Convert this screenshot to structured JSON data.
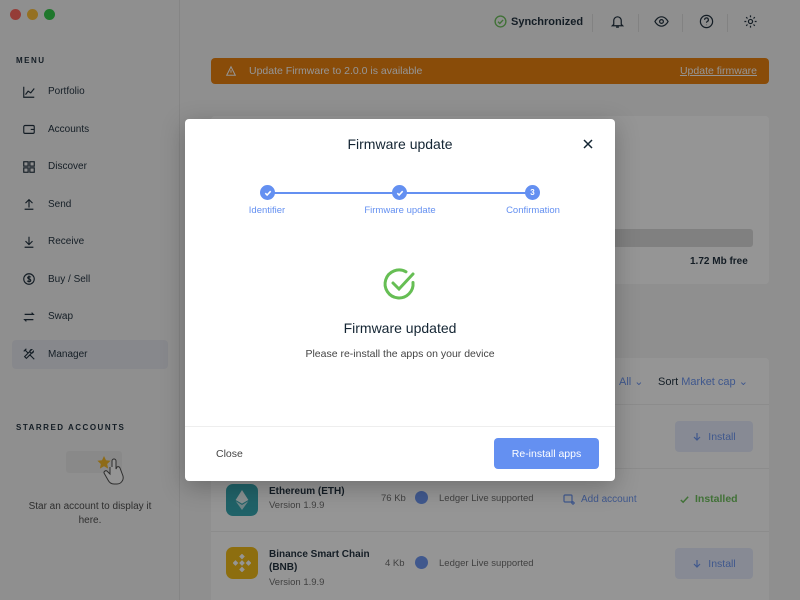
{
  "sidebar": {
    "menu_title": "MENU",
    "items": [
      {
        "label": "Portfolio",
        "icon": "chart-line-icon"
      },
      {
        "label": "Accounts",
        "icon": "wallet-icon"
      },
      {
        "label": "Discover",
        "icon": "grid-icon"
      },
      {
        "label": "Send",
        "icon": "arrow-up-icon"
      },
      {
        "label": "Receive",
        "icon": "arrow-down-icon"
      },
      {
        "label": "Buy / Sell",
        "icon": "dollar-icon"
      },
      {
        "label": "Swap",
        "icon": "swap-icon"
      },
      {
        "label": "Manager",
        "icon": "tools-icon",
        "active": true
      }
    ],
    "starred_title": "STARRED ACCOUNTS",
    "starred_empty": "Star an account to display it here."
  },
  "topbar": {
    "sync_label": "Synchronized"
  },
  "banner": {
    "text": "Update Firmware to 2.0.0 is available",
    "link": "Update firmware"
  },
  "storage": {
    "free": "1.72 Mb free"
  },
  "filters": {
    "show_value": "All",
    "sort_label": "Sort",
    "sort_value": "Market cap"
  },
  "apps": [
    {
      "name": "Ethereum (ETH)",
      "version": "Version 1.9.9",
      "size": "76 Kb",
      "support": "Ledger Live supported",
      "add_account": "Add account",
      "status": "Installed",
      "color": "#2aa3ad"
    },
    {
      "name": "Binance Smart Chain (BNB)",
      "version": "Version 1.9.9",
      "size": "4 Kb",
      "support": "Ledger Live supported",
      "action": "Install",
      "color": "#f0b90b"
    }
  ],
  "hidden_row": {
    "action": "Install"
  },
  "modal": {
    "title": "Firmware update",
    "steps": [
      {
        "label": "Identifier",
        "state": "done"
      },
      {
        "label": "Firmware update",
        "state": "done"
      },
      {
        "label": "Confirmation",
        "number": "3",
        "state": "current"
      }
    ],
    "result_title": "Firmware updated",
    "result_subtitle": "Please re-install the apps on your device",
    "close_label": "Close",
    "primary_label": "Re-install apps"
  },
  "colors": {
    "accent": "#6490f1",
    "banner": "#ea7a00",
    "success": "#66be54"
  }
}
